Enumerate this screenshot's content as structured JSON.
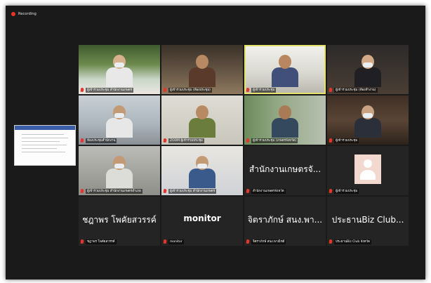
{
  "recording": {
    "label": "Recording"
  },
  "tiles": [
    {
      "name": "ผู้เข้าร่วมประชุม สำนักงานเกษตร",
      "kind": "video",
      "bg": "bg-leaf",
      "skin": "#d7b08c",
      "shirt": "#e8e8e8",
      "mask": true
    },
    {
      "name": "ผู้เข้าร่วมประชุม (ห้องประชุม)",
      "kind": "video",
      "bg": "bg-room1",
      "skin": "#b78a63",
      "shirt": "#5a3a2a",
      "mask": false
    },
    {
      "name": "ผู้เข้าร่วมประชุม",
      "kind": "video",
      "bg": "bg-office",
      "skin": "#b9875f",
      "shirt": "#41507a",
      "mask": false,
      "active": true
    },
    {
      "name": "ผู้เข้าร่วมประชุม (ห้องทำงาน)",
      "kind": "video",
      "bg": "bg-dark",
      "skin": "#d4a987",
      "shirt": "#1f1f24",
      "mask": true
    },
    {
      "name": "ห้องประชุมสำนักงาน",
      "kind": "video",
      "bg": "bg-meet",
      "skin": "#c49a74",
      "shirt": "#e7e7e7",
      "mask": true
    },
    {
      "name": "ZOOM ผู้เข้าร่วมประชุม",
      "kind": "video",
      "bg": "bg-wall",
      "skin": "#b78a63",
      "shirt": "#6a7d3c",
      "mask": false
    },
    {
      "name": "ผู้เข้าร่วมประชุม (เกษตรจังหวัด)",
      "kind": "video",
      "bg": "bg-green",
      "skin": "#a87a55",
      "shirt": "#34495e",
      "mask": false
    },
    {
      "name": "ผู้เข้าร่วมประชุม",
      "kind": "video",
      "bg": "bg-shelf",
      "skin": "#c9a282",
      "shirt": "#2b2f3a",
      "mask": true
    },
    {
      "name": "ผู้เข้าร่วมประชุม สำนักงานเกษตรอำเภอ",
      "kind": "video",
      "bg": "bg-grey",
      "skin": "#c49a74",
      "shirt": "#dcdcd8",
      "mask": true
    },
    {
      "name": "ผู้เข้าร่วมประชุม สำนักงานเกษตร",
      "kind": "video",
      "bg": "bg-blue",
      "skin": "#c49a74",
      "shirt": "#3a5a8c",
      "mask": true
    },
    {
      "name": "สำนักงานเกษตรจังหวัด",
      "kind": "text",
      "big": "สำนักงานเกษตรจั..."
    },
    {
      "name": "ผู้เข้าร่วมประชุม",
      "kind": "avatar"
    },
    {
      "name": "ชฎาพร โพคัยสวรรค์",
      "kind": "text",
      "big": "ชฎาพร โพคัยสวรรค์"
    },
    {
      "name": "monitor",
      "kind": "text",
      "big": "monitor",
      "bold": true
    },
    {
      "name": "จิตราภักษ์ สนง.พาณิชย์",
      "kind": "text",
      "big": "จิตราภักษ์ สนง.พา..."
    },
    {
      "name": "ประธานBiz Club จังหวัด",
      "kind": "text",
      "big": "ประธานBiz Club..."
    }
  ]
}
